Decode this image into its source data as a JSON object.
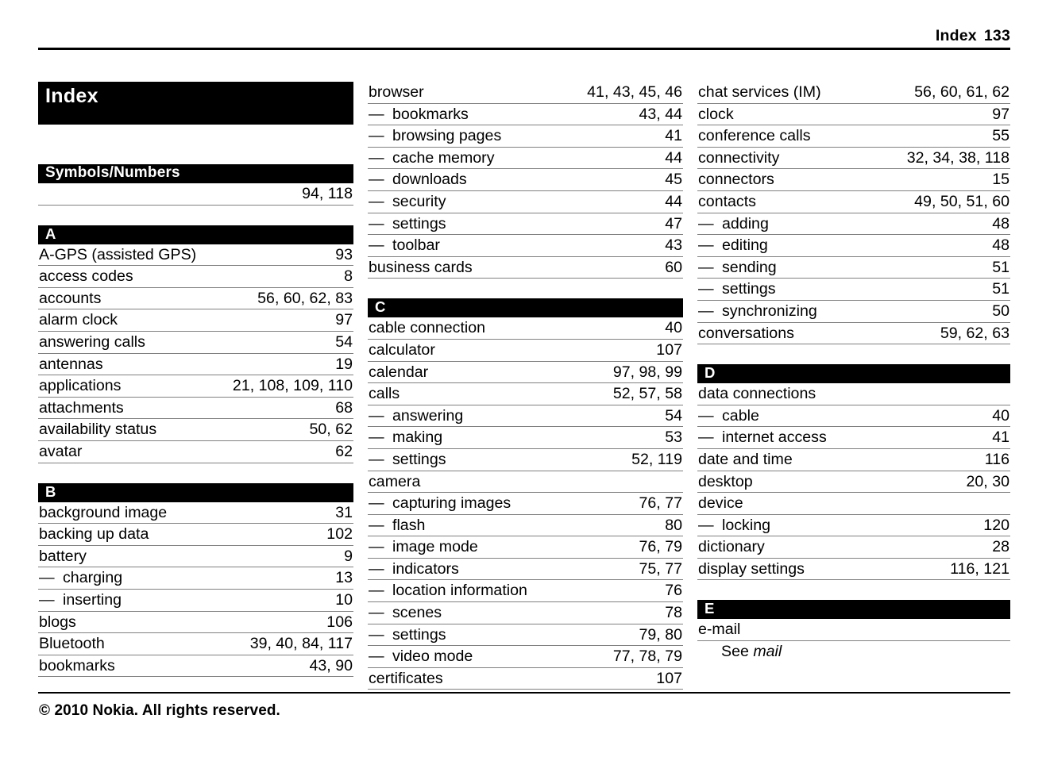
{
  "header": {
    "title": "Index",
    "page_number": "133"
  },
  "document_title": "Index",
  "footer": {
    "copyright": "© 2010 Nokia. All rights reserved."
  },
  "columns": [
    {
      "name": "column-1",
      "sections": [
        {
          "letter": "Symbols/Numbers",
          "entries": [
            {
              "label": "",
              "pages": "94, 118",
              "level": 0
            }
          ]
        },
        {
          "letter": "A",
          "entries": [
            {
              "label": "A-GPS (assisted GPS)",
              "pages": "93",
              "level": 0
            },
            {
              "label": "access codes",
              "pages": "8",
              "level": 0
            },
            {
              "label": "accounts",
              "pages": "56, 60, 62, 83",
              "level": 0
            },
            {
              "label": "alarm clock",
              "pages": "97",
              "level": 0
            },
            {
              "label": "answering calls",
              "pages": "54",
              "level": 0
            },
            {
              "label": "antennas",
              "pages": "19",
              "level": 0
            },
            {
              "label": "applications",
              "pages": "21, 108, 109, 110",
              "level": 0
            },
            {
              "label": "attachments",
              "pages": "68",
              "level": 0
            },
            {
              "label": "availability status",
              "pages": "50, 62",
              "level": 0
            },
            {
              "label": "avatar",
              "pages": "62",
              "level": 0
            }
          ]
        },
        {
          "letter": "B",
          "entries": [
            {
              "label": "background image",
              "pages": "31",
              "level": 0
            },
            {
              "label": "backing up data",
              "pages": "102",
              "level": 0
            },
            {
              "label": "battery",
              "pages": "9",
              "level": 0
            },
            {
              "label": "charging",
              "pages": "13",
              "level": 1
            },
            {
              "label": "inserting",
              "pages": "10",
              "level": 1
            },
            {
              "label": "blogs",
              "pages": "106",
              "level": 0
            },
            {
              "label": "Bluetooth",
              "pages": "39, 40, 84, 117",
              "level": 0
            },
            {
              "label": "bookmarks",
              "pages": "43, 90",
              "level": 0
            }
          ]
        }
      ]
    },
    {
      "name": "column-2",
      "sections": [
        {
          "letter": "",
          "entries": [
            {
              "label": "browser",
              "pages": "41, 43, 45, 46",
              "level": 0
            },
            {
              "label": "bookmarks",
              "pages": "43, 44",
              "level": 1
            },
            {
              "label": "browsing pages",
              "pages": "41",
              "level": 1
            },
            {
              "label": "cache memory",
              "pages": "44",
              "level": 1
            },
            {
              "label": "downloads",
              "pages": "45",
              "level": 1
            },
            {
              "label": "security",
              "pages": "44",
              "level": 1
            },
            {
              "label": "settings",
              "pages": "47",
              "level": 1
            },
            {
              "label": "toolbar",
              "pages": "43",
              "level": 1
            },
            {
              "label": "business cards",
              "pages": "60",
              "level": 0
            }
          ]
        },
        {
          "letter": "C",
          "entries": [
            {
              "label": "cable connection",
              "pages": "40",
              "level": 0
            },
            {
              "label": "calculator",
              "pages": "107",
              "level": 0
            },
            {
              "label": "calendar",
              "pages": "97, 98, 99",
              "level": 0
            },
            {
              "label": "calls",
              "pages": "52, 57, 58",
              "level": 0
            },
            {
              "label": "answering",
              "pages": "54",
              "level": 1
            },
            {
              "label": "making",
              "pages": "53",
              "level": 1
            },
            {
              "label": "settings",
              "pages": "52, 119",
              "level": 1
            },
            {
              "label": "camera",
              "pages": "",
              "level": 0
            },
            {
              "label": "capturing images",
              "pages": "76, 77",
              "level": 1
            },
            {
              "label": "flash",
              "pages": "80",
              "level": 1
            },
            {
              "label": "image mode",
              "pages": "76, 79",
              "level": 1
            },
            {
              "label": "indicators",
              "pages": "75, 77",
              "level": 1
            },
            {
              "label": "location information",
              "pages": "76",
              "level": 1
            },
            {
              "label": "scenes",
              "pages": "78",
              "level": 1
            },
            {
              "label": "settings",
              "pages": "79, 80",
              "level": 1
            },
            {
              "label": "video mode",
              "pages": "77, 78, 79",
              "level": 1
            },
            {
              "label": "certificates",
              "pages": "107",
              "level": 0
            }
          ]
        }
      ]
    },
    {
      "name": "column-3",
      "sections": [
        {
          "letter": "",
          "entries": [
            {
              "label": "chat services (IM)",
              "pages": "56, 60, 61, 62",
              "level": 0
            },
            {
              "label": "clock",
              "pages": "97",
              "level": 0
            },
            {
              "label": "conference calls",
              "pages": "55",
              "level": 0
            },
            {
              "label": "connectivity",
              "pages": "32, 34, 38, 118",
              "level": 0
            },
            {
              "label": "connectors",
              "pages": "15",
              "level": 0
            },
            {
              "label": "contacts",
              "pages": "49, 50, 51, 60",
              "level": 0
            },
            {
              "label": "adding",
              "pages": "48",
              "level": 1
            },
            {
              "label": "editing",
              "pages": "48",
              "level": 1
            },
            {
              "label": "sending",
              "pages": "51",
              "level": 1
            },
            {
              "label": "settings",
              "pages": "51",
              "level": 1
            },
            {
              "label": "synchronizing",
              "pages": "50",
              "level": 1
            },
            {
              "label": "conversations",
              "pages": "59, 62, 63",
              "level": 0
            }
          ]
        },
        {
          "letter": "D",
          "entries": [
            {
              "label": "data connections",
              "pages": "",
              "level": 0
            },
            {
              "label": "cable",
              "pages": "40",
              "level": 1
            },
            {
              "label": "internet access",
              "pages": "41",
              "level": 1
            },
            {
              "label": "date and time",
              "pages": "116",
              "level": 0
            },
            {
              "label": "desktop",
              "pages": "20, 30",
              "level": 0
            },
            {
              "label": "device",
              "pages": "",
              "level": 0
            },
            {
              "label": "locking",
              "pages": "120",
              "level": 1
            },
            {
              "label": "dictionary",
              "pages": "28",
              "level": 0
            },
            {
              "label": "display settings",
              "pages": "116, 121",
              "level": 0
            }
          ]
        },
        {
          "letter": "E",
          "entries": [
            {
              "label": "e-mail",
              "pages": "",
              "level": 0
            },
            {
              "label": "See",
              "cross_reference": "mail",
              "pages": "",
              "level": 2
            }
          ]
        }
      ]
    }
  ],
  "colors": {
    "band_background": "#000000",
    "band_text": "#ffffff",
    "rule_gray": "#808080",
    "rule_black": "#000000",
    "page_background": "#ffffff",
    "text": "#000000"
  }
}
